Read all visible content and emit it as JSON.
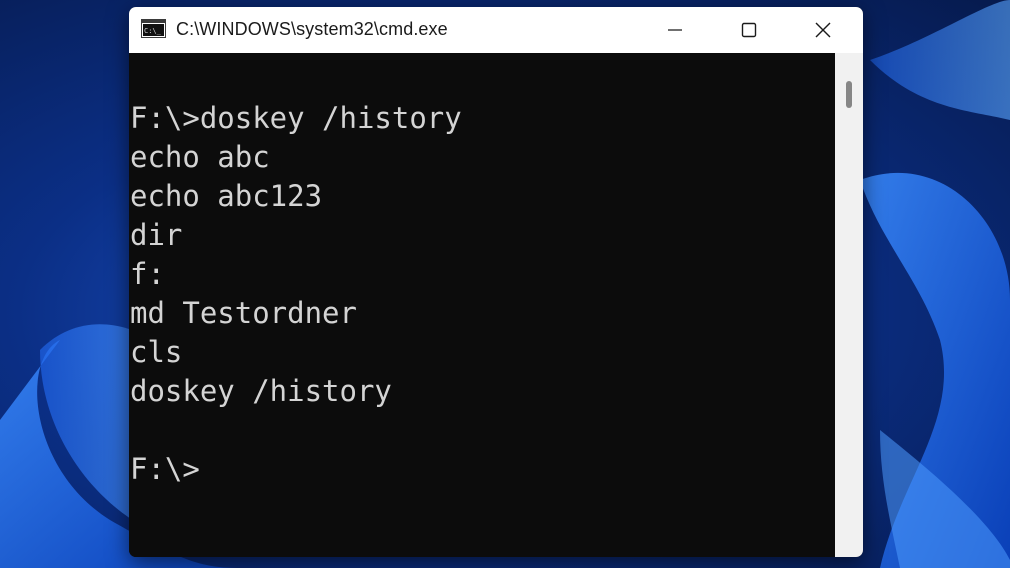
{
  "window": {
    "title": "C:\\WINDOWS\\system32\\cmd.exe",
    "icon": "cmd-app-icon"
  },
  "controls": {
    "minimize": "minimize-icon",
    "maximize": "maximize-icon",
    "close": "close-icon"
  },
  "console": {
    "lines": [
      "F:\\>doskey /history",
      "echo abc",
      "echo abc123",
      "dir",
      "f:",
      "md Testordner",
      "cls",
      "doskey /history",
      "",
      "F:\\>"
    ]
  },
  "colors": {
    "console_background": "#0c0c0c",
    "console_text": "#d4d4d4",
    "titlebar": "#ffffff",
    "wallpaper_accent": "#1d6ff0"
  }
}
